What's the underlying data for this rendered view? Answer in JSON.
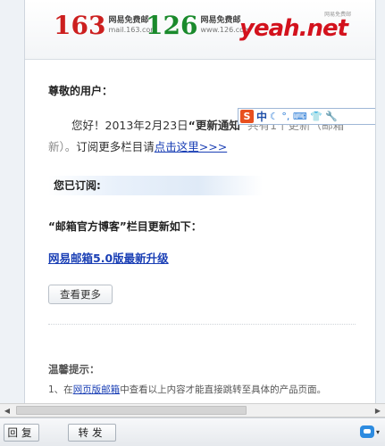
{
  "banner": {
    "logo163": {
      "num": "163",
      "cn": "网易免费邮",
      "url": "mail.163.com"
    },
    "logo126": {
      "num": "126",
      "cn": "网易免费邮",
      "url": "www.126.com"
    },
    "logoYeah": {
      "text": "yeah.net",
      "tag": "网易免费邮"
    }
  },
  "email": {
    "greeting": "尊敬的用户：",
    "intro_pre": "您好！2013年2月23日",
    "intro_bold": "“更新通知”",
    "intro_muted": "共有1个更新（邮箱",
    "intro_muted2": "新）。",
    "intro_mid": "订阅更多栏目请",
    "intro_link": "点击这里>>>",
    "subscribed": "您已订阅:",
    "section_title": "“邮箱官方博客”栏目更新如下：",
    "article_link": "网易邮箱5.0版最新升级",
    "more_button": "查看更多",
    "tips_title": "温馨提示：",
    "tips_1_pre": "1、在",
    "tips_1_link": "网页版邮箱",
    "tips_1_post": "中查看以上内容才能直接跳转至具体的产品页面。"
  },
  "ime": {
    "s": "S",
    "zh": "中",
    "icons": "☾ °, ⌨ 👕 🔧"
  },
  "toolbar": {
    "reply": "回复",
    "forward": "转发"
  },
  "icons": {
    "scroll_left": "◀",
    "scroll_right": "▶",
    "chat": "chat-bubble-icon",
    "caret": "▾"
  }
}
